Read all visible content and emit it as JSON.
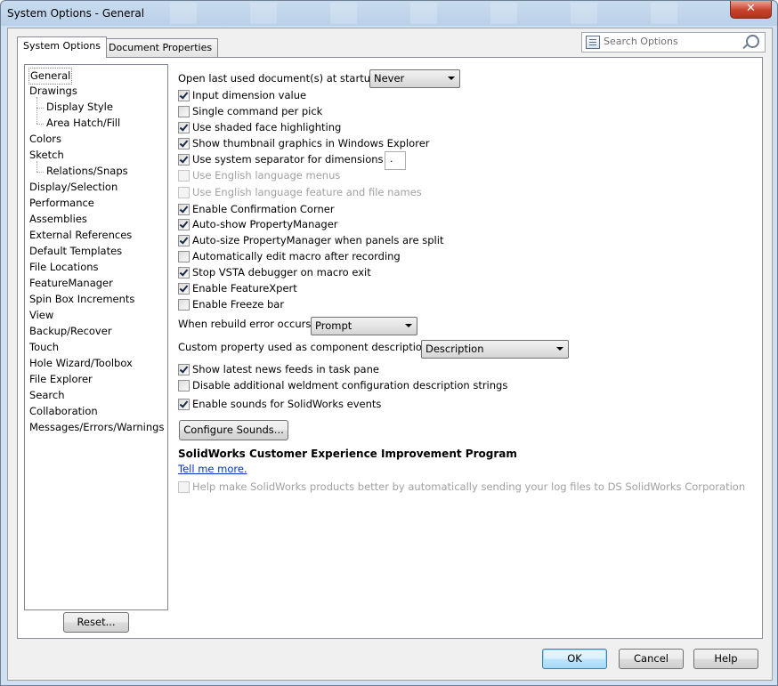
{
  "window": {
    "title": "System Options - General",
    "close_glyph": "✕"
  },
  "tabs": [
    {
      "label": "System Options",
      "active": true
    },
    {
      "label": "Document Properties",
      "active": false
    }
  ],
  "search": {
    "placeholder": "Search Options",
    "icon": "magnifier-icon"
  },
  "tree": {
    "items": [
      {
        "label": "General",
        "level": 0,
        "selected": true
      },
      {
        "label": "Drawings",
        "level": 0
      },
      {
        "label": "Display Style",
        "level": 1
      },
      {
        "label": "Area Hatch/Fill",
        "level": 1
      },
      {
        "label": "Colors",
        "level": 0
      },
      {
        "label": "Sketch",
        "level": 0
      },
      {
        "label": "Relations/Snaps",
        "level": 1
      },
      {
        "label": "Display/Selection",
        "level": 0
      },
      {
        "label": "Performance",
        "level": 0
      },
      {
        "label": "Assemblies",
        "level": 0
      },
      {
        "label": "External References",
        "level": 0
      },
      {
        "label": "Default Templates",
        "level": 0
      },
      {
        "label": "File Locations",
        "level": 0
      },
      {
        "label": "FeatureManager",
        "level": 0
      },
      {
        "label": "Spin Box Increments",
        "level": 0
      },
      {
        "label": "View",
        "level": 0
      },
      {
        "label": "Backup/Recover",
        "level": 0
      },
      {
        "label": "Touch",
        "level": 0
      },
      {
        "label": "Hole Wizard/Toolbox",
        "level": 0
      },
      {
        "label": "File Explorer",
        "level": 0
      },
      {
        "label": "Search",
        "level": 0
      },
      {
        "label": "Collaboration",
        "level": 0
      },
      {
        "label": "Messages/Errors/Warnings",
        "level": 0
      }
    ],
    "reset_label": "Reset..."
  },
  "options": {
    "open_last_label": "Open last used document(s) at startup:",
    "open_last_value": "Never",
    "checkboxes_group1": [
      {
        "label": "Input dimension value",
        "checked": true,
        "enabled": true
      },
      {
        "label": "Single command per pick",
        "checked": false,
        "enabled": true
      },
      {
        "label": "Use shaded face highlighting",
        "checked": true,
        "enabled": true
      },
      {
        "label": "Show thumbnail graphics in Windows Explorer",
        "checked": true,
        "enabled": true
      },
      {
        "label": "Use system separator for dimensions",
        "checked": true,
        "enabled": true
      },
      {
        "label": "Use English language menus",
        "checked": false,
        "enabled": false
      },
      {
        "label": "Use English language feature and file names",
        "checked": false,
        "enabled": false
      },
      {
        "label": "Enable Confirmation Corner",
        "checked": true,
        "enabled": true
      },
      {
        "label": "Auto-show PropertyManager",
        "checked": true,
        "enabled": true
      },
      {
        "label": "Auto-size PropertyManager when panels are split",
        "checked": true,
        "enabled": true
      },
      {
        "label": "Automatically edit macro after recording",
        "checked": false,
        "enabled": true
      },
      {
        "label": "Stop VSTA debugger on macro exit",
        "checked": true,
        "enabled": true
      },
      {
        "label": "Enable FeatureXpert",
        "checked": true,
        "enabled": true
      },
      {
        "label": "Enable Freeze bar",
        "checked": false,
        "enabled": true
      }
    ],
    "separator_value": ".",
    "rebuild_label": "When rebuild error occurs:",
    "rebuild_value": "Prompt",
    "custom_prop_label": "Custom property used as component description:",
    "custom_prop_value": "Description",
    "checkboxes_group2": [
      {
        "label": "Show latest news feeds in task pane",
        "checked": true,
        "enabled": true
      },
      {
        "label": "Disable additional weldment configuration description strings",
        "checked": false,
        "enabled": true
      }
    ],
    "sounds_checkbox": {
      "label": "Enable sounds for SolidWorks events",
      "checked": true,
      "enabled": true
    },
    "configure_sounds_label": "Configure Sounds...",
    "ceip_heading": "SolidWorks Customer Experience Improvement Program",
    "ceip_link": "Tell me more.",
    "ceip_checkbox": {
      "label": "Help make SolidWorks products better by automatically sending your log files to DS SolidWorks Corporation",
      "checked": false,
      "enabled": false
    }
  },
  "footer": {
    "ok_label": "OK",
    "cancel_label": "Cancel",
    "help_label": "Help"
  }
}
